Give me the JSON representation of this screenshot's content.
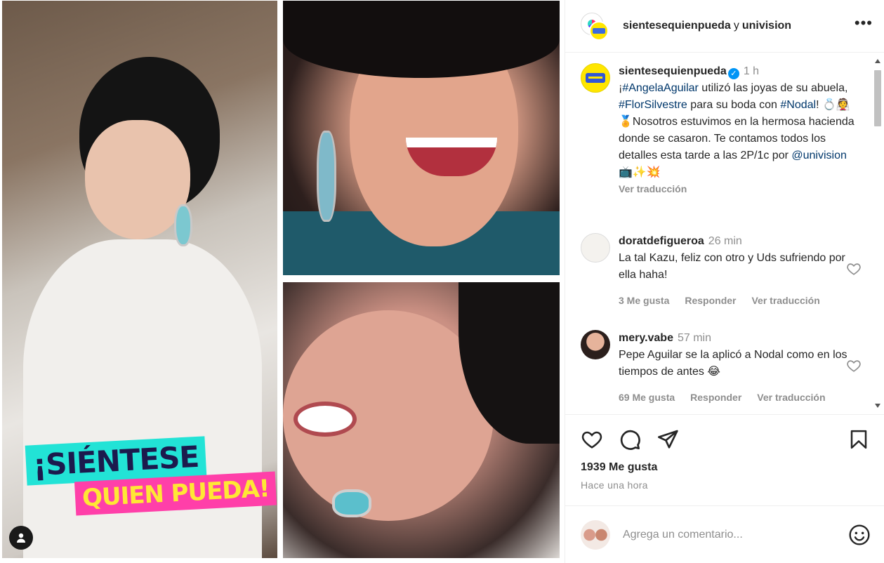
{
  "media": {
    "logo_line1": "¡SIÉNTESE",
    "logo_line2": "QUIEN PUEDA!"
  },
  "header": {
    "account1": "sientesequienpueda",
    "joiner": "y",
    "account2": "univision",
    "more_label": "•••"
  },
  "caption": {
    "username": "sientesequienpueda",
    "verified": "✓",
    "time": "1 h",
    "parts": {
      "p1": "¡",
      "t1": "#AngelaAguilar",
      "p2": " utilizó las joyas de su abuela, ",
      "t2": "#FlorSilvestre",
      "p3": " para su boda con ",
      "t3": "#Nodal",
      "p4": "! 💍👰🏅Nosotros estuvimos en la hermosa hacienda donde se casaron. Te contamos todos los detalles esta tarde a las 2P/1c por ",
      "t4": "@univision",
      "p5": " 📺✨💥"
    },
    "see_translation": "Ver traducción"
  },
  "comments": [
    {
      "username": "doratdefigueroa",
      "time": "26 min",
      "text": "La tal Kazu, feliz con otro y Uds sufriendo por ella haha!",
      "likes": "3 Me gusta",
      "reply": "Responder",
      "translate": "Ver traducción"
    },
    {
      "username": "mery.vabe",
      "time": "57 min",
      "text": "Pepe Aguilar se la aplicó a Nodal como en los tiempos de antes 😂",
      "likes": "69 Me gusta",
      "reply": "Responder",
      "translate": "Ver traducción"
    }
  ],
  "actions": {
    "likes": "1939 Me gusta",
    "posted": "Hace una hora"
  },
  "add_comment": {
    "placeholder": "Agrega un comentario..."
  },
  "icons": {
    "like": "heart-icon",
    "comment": "comment-icon",
    "share": "paper-plane-icon",
    "save": "bookmark-icon",
    "emoji": "smiley-icon",
    "more": "more-horizontal-icon",
    "user_tag": "person-icon"
  },
  "colors": {
    "link": "#00376b",
    "verified": "#0095f6",
    "muted": "#8e8e8e",
    "logo_cyan": "#22e3d6",
    "logo_pink": "#ff3fa9",
    "logo_yellow": "#ffe735"
  }
}
